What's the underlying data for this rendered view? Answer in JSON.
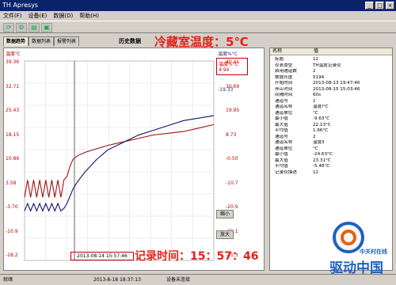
{
  "window": {
    "title": "TH Apresys"
  },
  "menu": [
    "文件(F)",
    "设备(E)",
    "数据(D)",
    "帮助(H)"
  ],
  "tabs": [
    "数据趋势",
    "数据列表",
    "报警列表"
  ],
  "chart_header": "历史数据",
  "big_title": "冷藏室温度：5℃",
  "chart": {
    "left_unit": "温度℃",
    "right_unit": "温度%°C",
    "left_ticks": [
      "39.36",
      "32.71",
      "25.43",
      "18.15",
      "10.86",
      "3.58",
      "-3.70",
      "-10.9",
      "-18.2"
    ],
    "right_ticks": [
      "40.41",
      "30.69",
      "19.95",
      "8.73",
      "-0.50",
      "-10.7",
      "-20.9",
      "-31.1",
      "-41.3"
    ],
    "legend1_label": "温度%°C",
    "legend1_value": "4.94",
    "legend2_value": "-19.33",
    "zoom_in": "缩小",
    "zoom_out": "放大",
    "cursor_time": "2013-08-14 15:57:46"
  },
  "record_label": "记录时间：15：57：46",
  "table": {
    "headers": [
      "名称",
      "值"
    ],
    "rows": [
      [
        "标题",
        "12"
      ],
      [
        "仪表类型",
        "TH温度记录仪"
      ],
      [
        "启用通道数",
        "2"
      ],
      [
        "数据长度",
        "5194"
      ],
      [
        "开始时间",
        "2013-08-13 19:47:46"
      ],
      [
        "停止时间",
        "2013-08-15 15:03:46"
      ],
      [
        "间隔时间",
        "60s"
      ],
      [
        "通道号",
        "1"
      ],
      [
        "通道名称",
        "温度I°C"
      ],
      [
        "通道单位",
        "°C"
      ],
      [
        "最小值",
        "-9.63°C"
      ],
      [
        "最大值",
        "22.13°C"
      ],
      [
        "平均值",
        "1.66°C"
      ],
      [
        "通道号",
        "2"
      ],
      [
        "通道名称",
        "温度II"
      ],
      [
        "通道单位",
        "°C"
      ],
      [
        "最小值",
        "-24.63°C"
      ],
      [
        "最大值",
        "23.31°C"
      ],
      [
        "平均值",
        "-5.48°C"
      ],
      [
        "记录仪描述",
        "12"
      ]
    ]
  },
  "status": {
    "left": "就绪",
    "time": "2013-8-18 18:37:13",
    "conn": "设备未连接"
  },
  "chart_data": {
    "type": "line",
    "series": [
      {
        "name": "温度I°C",
        "axis": "left",
        "x": [
          0,
          4,
          8,
          12,
          16,
          20,
          24,
          28,
          32,
          36,
          40,
          44,
          48,
          52,
          56,
          60,
          64,
          70,
          80,
          95,
          110,
          130,
          150,
          170,
          190,
          210,
          230,
          250
        ],
        "y": [
          0,
          5,
          0,
          5,
          0,
          5,
          0,
          5,
          0,
          5,
          0,
          5,
          0,
          5,
          6,
          9,
          11,
          12,
          13,
          14,
          15,
          16,
          17,
          18,
          18.5,
          19,
          20,
          21
        ]
      },
      {
        "name": "温度II",
        "axis": "right",
        "x": [
          0,
          4,
          8,
          12,
          16,
          20,
          24,
          28,
          32,
          36,
          40,
          44,
          48,
          52,
          56,
          60,
          64,
          70,
          80,
          95,
          110,
          130,
          150,
          170,
          190,
          210,
          230,
          250
        ],
        "y": [
          -21,
          -18,
          -21,
          -18,
          -21,
          -18,
          -21,
          -18,
          -21,
          -18,
          -21,
          -18,
          -21,
          -20,
          -18,
          -15,
          -12,
          -9,
          -5,
          0,
          4,
          7,
          10,
          12,
          14,
          16,
          17,
          18
        ]
      }
    ],
    "left_ylim": [
      -18.2,
      39.36
    ],
    "right_ylim": [
      -41.3,
      40.41
    ],
    "grid": true
  }
}
